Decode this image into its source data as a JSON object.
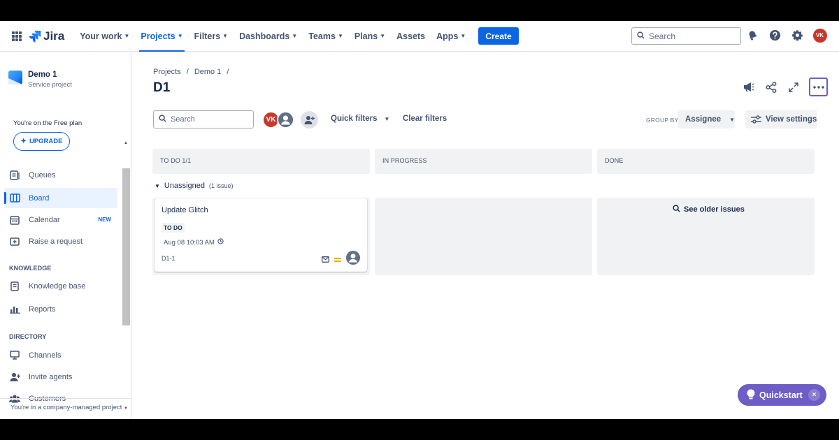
{
  "topnav": {
    "logo_text": "Jira",
    "items": [
      {
        "label": "Your work",
        "active": false
      },
      {
        "label": "Projects",
        "active": true
      },
      {
        "label": "Filters",
        "active": false
      },
      {
        "label": "Dashboards",
        "active": false
      },
      {
        "label": "Teams",
        "active": false
      },
      {
        "label": "Plans",
        "active": false
      },
      {
        "label": "Assets",
        "active": false
      },
      {
        "label": "Apps",
        "active": false
      }
    ],
    "create_label": "Create",
    "search_placeholder": "Search",
    "user_initials": "VK"
  },
  "sidebar": {
    "project_name": "Demo 1",
    "project_type": "Service project",
    "plan_text": "You're on the Free plan",
    "upgrade_label": "UPGRADE",
    "items": [
      {
        "label": "Queues",
        "icon": "queues-icon"
      },
      {
        "label": "Board",
        "icon": "board-icon",
        "active": true
      },
      {
        "label": "Calendar",
        "icon": "calendar-icon",
        "badge": "NEW"
      },
      {
        "label": "Raise a request",
        "icon": "raise-request-icon"
      }
    ],
    "knowledge_heading": "KNOWLEDGE",
    "knowledge_items": [
      {
        "label": "Knowledge base",
        "icon": "knowledge-base-icon"
      },
      {
        "label": "Reports",
        "icon": "reports-icon"
      }
    ],
    "directory_heading": "DIRECTORY",
    "directory_items": [
      {
        "label": "Channels",
        "icon": "channels-icon"
      },
      {
        "label": "Invite agents",
        "icon": "invite-agents-icon"
      },
      {
        "label": "Customers",
        "icon": "customers-icon"
      }
    ],
    "footer": "You're in a company-managed project"
  },
  "main": {
    "breadcrumb": [
      "Projects",
      "/",
      "Demo 1",
      "/"
    ],
    "title": "D1",
    "search_placeholder": "Search",
    "avatar_initials": "VK",
    "quick_filters_label": "Quick filters",
    "clear_filters_label": "Clear filters",
    "group_by_label": "GROUP BY",
    "group_by_value": "Assignee",
    "view_settings_label": "View settings",
    "columns": [
      {
        "title": "TO DO 1/1"
      },
      {
        "title": "IN PROGRESS"
      },
      {
        "title": "DONE"
      }
    ],
    "swimlane": {
      "label": "Unassigned",
      "count": "(1 issue)"
    },
    "card": {
      "title": "Update Glitch",
      "status": "TO DO",
      "date": "Aug 08 10:03 AM",
      "key": "D1-1"
    },
    "older_issues_label": "See older issues"
  },
  "quickstart": {
    "label": "Quickstart",
    "close": "×"
  },
  "colors": {
    "accent": "#0c66e4",
    "quickstart": "#6e5dc6",
    "avatar": "#c9372c"
  }
}
